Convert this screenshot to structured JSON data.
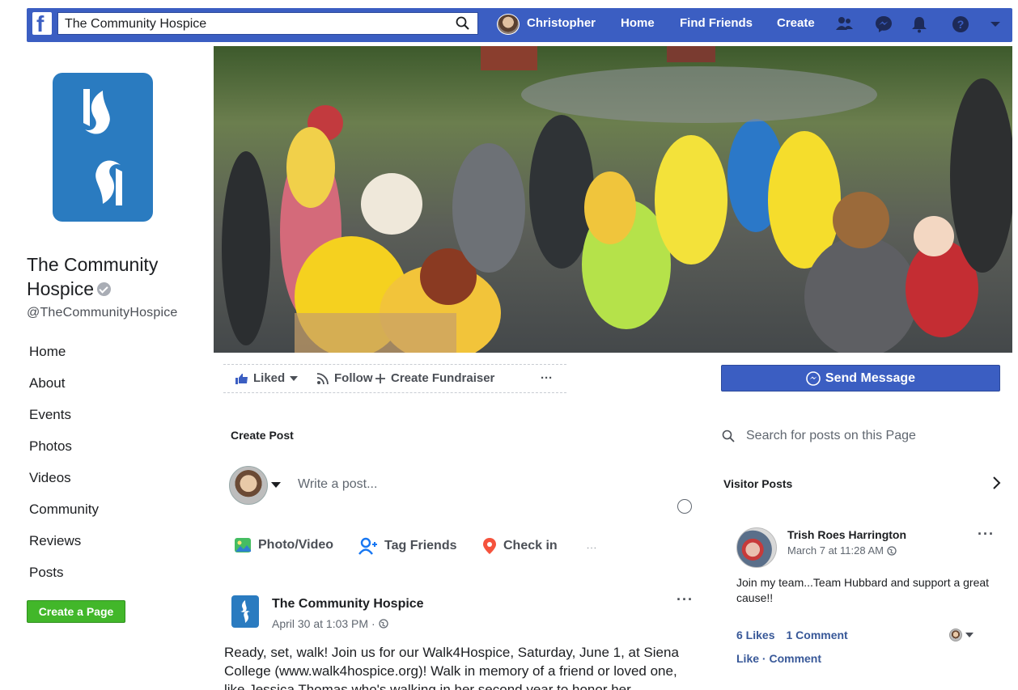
{
  "topbar": {
    "logo": "f",
    "search_value": "The Community Hospice",
    "user_name": "Christopher",
    "links": [
      "Home",
      "Find Friends",
      "Create"
    ],
    "icons": [
      "friends-icon",
      "messenger-icon",
      "notifications-icon",
      "help-icon",
      "account-menu-icon"
    ]
  },
  "page": {
    "name": "The Community Hospice",
    "handle": "@TheCommunityHospice",
    "nav": [
      "Home",
      "About",
      "Events",
      "Photos",
      "Videos",
      "Community",
      "Reviews",
      "Posts"
    ],
    "create_page_label": "Create a Page"
  },
  "actions": {
    "liked": "Liked",
    "follow": "Follow",
    "create_fundraiser": "Create Fundraiser",
    "more": "···",
    "send_message": "Send Message"
  },
  "composer": {
    "title": "Create Post",
    "placeholder": "Write a post...",
    "options": [
      "Photo/Video",
      "Tag Friends",
      "Check in"
    ],
    "more": "···"
  },
  "post": {
    "author": "The Community Hospice",
    "time": "April 30 at 1:03 PM ·",
    "more": "···",
    "text": "Ready, set, walk! Join us for our Walk4Hospice, Saturday, June 1, at Siena College (www.walk4hospice.org)! Walk in memory of a friend or loved one, like Jessica Thomas who's walking in her second year to honor her"
  },
  "sidebar": {
    "search_placeholder": "Search for posts on this Page",
    "visitor_posts_title": "Visitor Posts",
    "visitor_post": {
      "author": "Trish Roes Harrington",
      "time": "March 7 at 11:28 AM",
      "text": "Join my team...Team Hubbard and support a great cause!!",
      "likes": "6 Likes",
      "comments": "1 Comment",
      "links": "Like · Comment",
      "more": "···"
    }
  },
  "colors": {
    "brand_blue": "#3b5ec2",
    "logo_blue": "#2a7bc0",
    "create_green": "#42b72a",
    "link_blue": "#385898"
  }
}
